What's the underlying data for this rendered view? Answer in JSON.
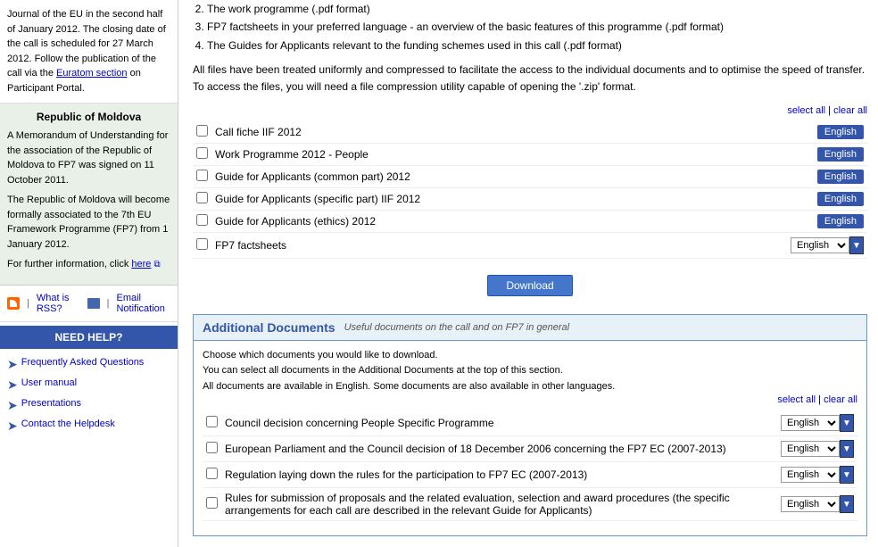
{
  "sidebar": {
    "journal_text": "Journal of the EU in the second half of January 2012. The closing date of the call is scheduled for 27 March 2012. Follow the publication of the call via the Euratom section on Participant Portal.",
    "euratom_link": "Euratom section",
    "republic_title": "Republic of Moldova",
    "republic_p1": "A Memorandum of Understanding for the association of the Republic of Moldova to FP7 was signed on 11 October 2011.",
    "republic_p2": "The Republic of Moldova will become formally associated to the 7th EU Framework Programme (FP7) from 1 January 2012.",
    "republic_p3": "For further information, click here",
    "rss_label": "What is RSS?",
    "email_label": "Email Notification",
    "need_help": "NEED HELP?",
    "help_items": [
      {
        "label": "Frequently Asked Questions"
      },
      {
        "label": "User manual"
      },
      {
        "label": "Presentations"
      },
      {
        "label": "Contact the Helpdesk"
      }
    ]
  },
  "main": {
    "intro_lines": [
      "All files have been treated uniformly and compressed to facilitate the access to the individual documents and to optimise the speed of transfer. To access the files, you will need a file compression utility capable of opening the '.zip' format."
    ],
    "select_all": "select all",
    "clear_all": "clear all",
    "documents": [
      {
        "id": 1,
        "name": "Call fiche IIF 2012",
        "lang_type": "button",
        "lang": "English"
      },
      {
        "id": 2,
        "name": "Work Programme 2012 - People",
        "lang_type": "button",
        "lang": "English"
      },
      {
        "id": 3,
        "name": "Guide for Applicants (common part) 2012",
        "lang_type": "button",
        "lang": "English"
      },
      {
        "id": 4,
        "name": "Guide for Applicants (specific part) IIF 2012",
        "lang_type": "button",
        "lang": "English"
      },
      {
        "id": 5,
        "name": "Guide for Applicants (ethics) 2012",
        "lang_type": "button",
        "lang": "English"
      },
      {
        "id": 6,
        "name": "FP7 factsheets",
        "lang_type": "dropdown",
        "lang": "English"
      }
    ],
    "download_label": "Download",
    "numbered_items": [
      "The work programme (.pdf format)",
      "FP7 factsheets in your preferred language - an overview of the basic features of this programme (.pdf format)",
      "The Guides for Applicants relevant to the funding schemes used in this call (.pdf format)"
    ],
    "additional": {
      "title": "Additional Documents",
      "subtitle": "Useful documents on the call and on FP7 in general",
      "desc1": "Choose which documents you would like to download.",
      "desc2": "You can select all documents in the Additional Documents at the top of this section.",
      "desc3": "All documents are available in English. Some documents are also available in other languages.",
      "select_all": "select all",
      "clear_all": "clear all",
      "docs": [
        {
          "id": 1,
          "name": "Council decision concerning People Specific Programme",
          "lang": "English"
        },
        {
          "id": 2,
          "name": "European Parliament and the Council decision of 18 December 2006 concerning the FP7 EC (2007-2013)",
          "lang": "English"
        },
        {
          "id": 3,
          "name": "Regulation laying down the rules for the participation to FP7 EC (2007-2013)",
          "lang": "English"
        },
        {
          "id": 4,
          "name": "Rules for submission of proposals and the related evaluation, selection and award procedures (the specific arrangements for each call are described in the relevant Guide for Applicants)",
          "lang": "English"
        }
      ]
    }
  }
}
